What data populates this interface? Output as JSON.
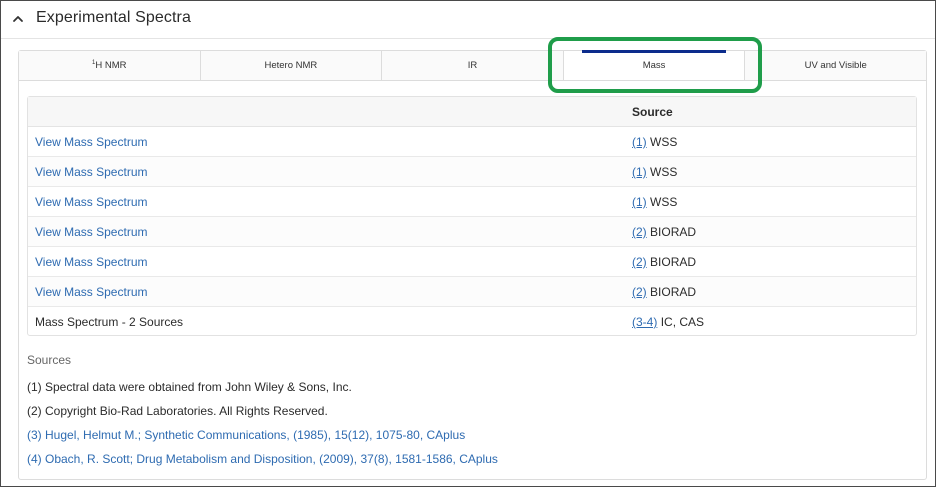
{
  "section": {
    "title": "Experimental Spectra",
    "collapse_icon": "chevron-up-icon"
  },
  "tabs": [
    {
      "label_prefix": "1",
      "label": "H NMR",
      "active": false
    },
    {
      "label": "Hetero NMR",
      "active": false
    },
    {
      "label": "IR",
      "active": false
    },
    {
      "label": "Mass",
      "active": true
    },
    {
      "label": "UV and Visible",
      "active": false
    }
  ],
  "colors": {
    "active_tab_bar": "#0c2c8c",
    "highlight": "#1f9d4a",
    "link": "#2e6bb1"
  },
  "table": {
    "source_header": "Source",
    "rows": [
      {
        "name": "View Mass Spectrum",
        "ref": "(1)",
        "source": "WSS"
      },
      {
        "name": "View Mass Spectrum",
        "ref": "(1)",
        "source": "WSS"
      },
      {
        "name": "View Mass Spectrum",
        "ref": "(1)",
        "source": "WSS"
      },
      {
        "name": "View Mass Spectrum",
        "ref": "(2)",
        "source": "BIORAD"
      },
      {
        "name": "View Mass Spectrum",
        "ref": "(2)",
        "source": "BIORAD"
      },
      {
        "name": "View Mass Spectrum",
        "ref": "(2)",
        "source": "BIORAD"
      },
      {
        "name": "Mass Spectrum - 2 Sources",
        "ref": "(3-4)",
        "source": "IC, CAS"
      }
    ]
  },
  "sources": {
    "title": "Sources",
    "items": [
      "(1) Spectral data were obtained from John Wiley & Sons, Inc.",
      "(2) Copyright Bio-Rad Laboratories. All Rights Reserved.",
      "(3) Hugel, Helmut M.; Synthetic Communications, (1985), 15(12), 1075-80, CAplus",
      "(4) Obach, R. Scott; Drug Metabolism and Disposition, (2009), 37(8), 1581-1586, CAplus"
    ]
  }
}
